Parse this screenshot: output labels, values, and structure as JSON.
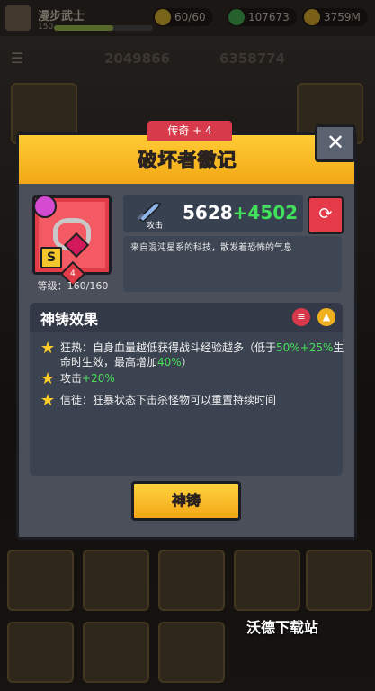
{
  "player": {
    "name": "漫步武士",
    "level": "150",
    "energy": "60/60",
    "gems": "107673",
    "gold": "3759M"
  },
  "background_stats": {
    "attack": "2049866",
    "hp": "6358774"
  },
  "modal": {
    "rarity": "传奇 + 4",
    "title": "破坏者徽记",
    "close_glyph": "✕",
    "item": {
      "grade": "S",
      "stars": "4",
      "level_text": "等级：160/160"
    },
    "attack_label": "攻击",
    "power_base": "5628",
    "power_bonus": "+4502",
    "description": "来自混沌星系的科技，散发着恐怖的气息",
    "effects_title": "神铸效果",
    "effects": [
      {
        "parts": [
          {
            "t": "狂热：自身血量越低获得战斗经验越多（低于",
            "g": false
          },
          {
            "t": "50%",
            "g": true
          },
          {
            "t": "+25%",
            "g": true
          },
          {
            "t": "生命时生效，最高增加",
            "g": false
          },
          {
            "t": "40%",
            "g": true
          },
          {
            "t": "）",
            "g": false
          }
        ]
      },
      {
        "parts": [
          {
            "t": "攻击",
            "g": false
          },
          {
            "t": "+20%",
            "g": true
          }
        ]
      },
      {
        "parts": [
          {
            "t": "信徒：狂暴状态下击杀怪物可以重置持续时间",
            "g": false
          }
        ]
      }
    ],
    "forge_button": "神铸"
  },
  "watermark": "沃德下载站",
  "colors": {
    "header_yellow": "#f7b51e",
    "rarity_red": "#d73a4b",
    "bonus_green": "#41e05a",
    "panel_gray": "#4a4f5a"
  }
}
